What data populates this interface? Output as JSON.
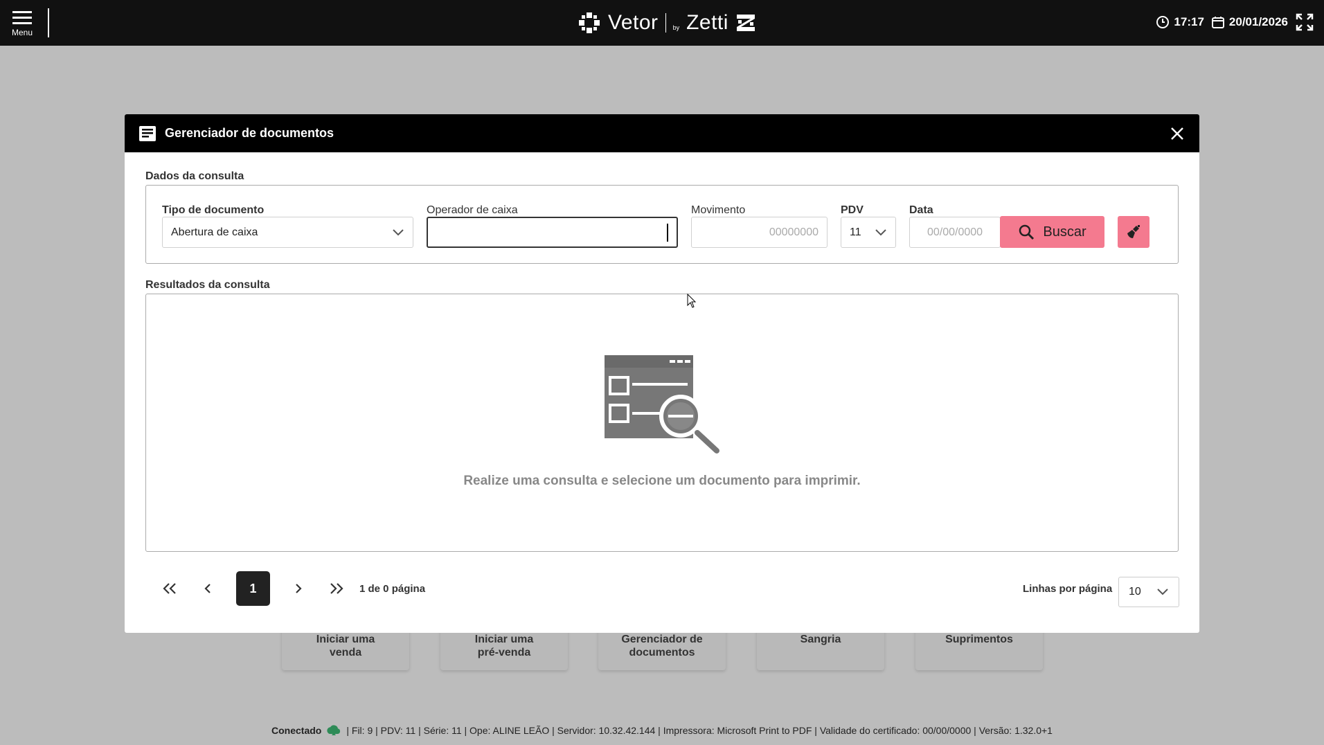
{
  "topbar": {
    "menu_label": "Menu",
    "brand_left": "Vetor",
    "brand_by": "by",
    "brand_right": "Zetti",
    "time": "17:17",
    "date": "20/01/2026"
  },
  "background_tiles": [
    {
      "line1": "Iniciar uma",
      "line2": "venda"
    },
    {
      "line1": "Iniciar uma",
      "line2": "pré-venda"
    },
    {
      "line1": "Gerenciador de",
      "line2": "documentos"
    },
    {
      "line1": "Sangria",
      "line2": ""
    },
    {
      "line1": "Suprimentos",
      "line2": ""
    }
  ],
  "modal": {
    "title": "Gerenciador de documentos",
    "query_section_title": "Dados da consulta",
    "fields": {
      "tipo_label": "Tipo de documento",
      "tipo_value": "Abertura de caixa",
      "operador_label": "Operador de caixa",
      "operador_value": "",
      "movimento_label": "Movimento",
      "movimento_placeholder": "00000000",
      "pdv_label": "PDV",
      "pdv_value": "11",
      "data_label": "Data",
      "data_placeholder": "00/00/0000"
    },
    "search_button_label": "Buscar",
    "results_section_title": "Resultados da consulta",
    "empty_message": "Realize uma consulta e selecione um documento para imprimir.",
    "pagination": {
      "current_page": "1",
      "info": "1 de 0 página",
      "rows_label": "Linhas por página",
      "rows_value": "10"
    }
  },
  "statusbar": {
    "connected": "Conectado",
    "details": "| Fil: 9 | PDV: 11 | Série: 11 | Ope: ALINE LEÃO | Servidor: 10.32.42.144 | Impressora: Microsoft Print to PDF | Validade do certificado: 00/00/0000 | Versão: 1.32.0+1"
  },
  "colors": {
    "topbar": "#111111",
    "accent_pink": "#f47a8f",
    "overlay_gray": "#bcbcbc",
    "connected_icon": "#2e8b57"
  },
  "icons": [
    "menu-icon",
    "vetor-logo-icon",
    "zetti-logo-icon",
    "clock-icon",
    "calendar-icon",
    "fullscreen-icon",
    "document-icon",
    "close-icon",
    "chevron-down-icon",
    "search-icon",
    "broom-icon",
    "empty-search-illustration",
    "first-page-icon",
    "prev-page-icon",
    "next-page-icon",
    "last-page-icon",
    "cloud-icon"
  ]
}
